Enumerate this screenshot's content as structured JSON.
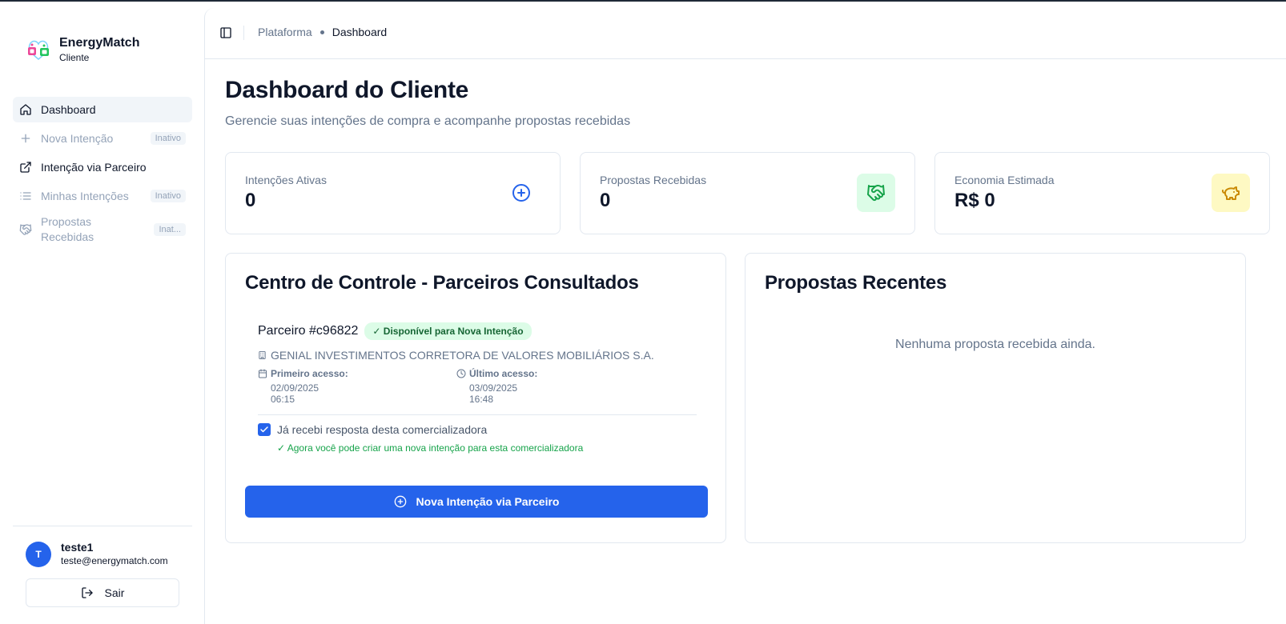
{
  "brand": {
    "name": "EnergyMatch",
    "subtitle": "Cliente"
  },
  "sidebar": {
    "items": [
      {
        "label": "Dashboard",
        "icon": "home-icon",
        "state": "active"
      },
      {
        "label": "Nova Intenção",
        "icon": "plus-icon",
        "state": "disabled",
        "badge": "Inativo"
      },
      {
        "label": "Intenção via Parceiro",
        "icon": "external-link-icon",
        "state": "normal"
      },
      {
        "label": "Minhas Intenções",
        "icon": "list-icon",
        "state": "disabled",
        "badge": "Inativo"
      },
      {
        "label": "Propostas\nRecebidas",
        "icon": "handshake-icon",
        "state": "disabled",
        "badge": "Inat..."
      }
    ]
  },
  "user": {
    "initial": "T",
    "name": "teste1",
    "email": "teste@energymatch.com",
    "logout_label": "Sair"
  },
  "header": {
    "crumb_parent": "Plataforma",
    "crumb_current": "Dashboard"
  },
  "page": {
    "title": "Dashboard do Cliente",
    "subtitle": "Gerencie suas intenções de compra e acompanhe propostas recebidas"
  },
  "stats": [
    {
      "label": "Intenções Ativas",
      "value": "0",
      "icon": "plus-circle-icon"
    },
    {
      "label": "Propostas Recebidas",
      "value": "0",
      "icon": "handshake-icon",
      "bg": "#dcfce7",
      "color": "#16a34a"
    },
    {
      "label": "Economia Estimada",
      "value": "R$ 0",
      "icon": "piggy-bank-icon",
      "bg": "#fef9c3",
      "color": "#ca8a04"
    }
  ],
  "control_center": {
    "title": "Centro de Controle - Parceiros Consultados",
    "partner": {
      "id": "Parceiro #c96822",
      "status": "✓ Disponível para Nova Intenção",
      "company": "GENIAL INVESTIMENTOS CORRETORA DE VALORES MOBILIÁRIOS S.A.",
      "first_access_label": "Primeiro acesso:",
      "first_access_value": "02/09/2025 06:15",
      "last_access_label": "Último acesso:",
      "last_access_value": "03/09/2025 16:48",
      "checkbox_label": "Já recebi resposta desta comercializadora",
      "checkbox_checked": true,
      "confirmation": "✓ Agora você pode criar uma nova intenção para esta comercializadora"
    },
    "button_label": "Nova Intenção via Parceiro"
  },
  "recent": {
    "title": "Propostas Recentes",
    "empty_text": "Nenhuma proposta recebida ainda."
  },
  "colors": {
    "primary": "#2563eb",
    "success": "#16a34a",
    "muted": "#64748b",
    "border": "#e2e8f0"
  }
}
